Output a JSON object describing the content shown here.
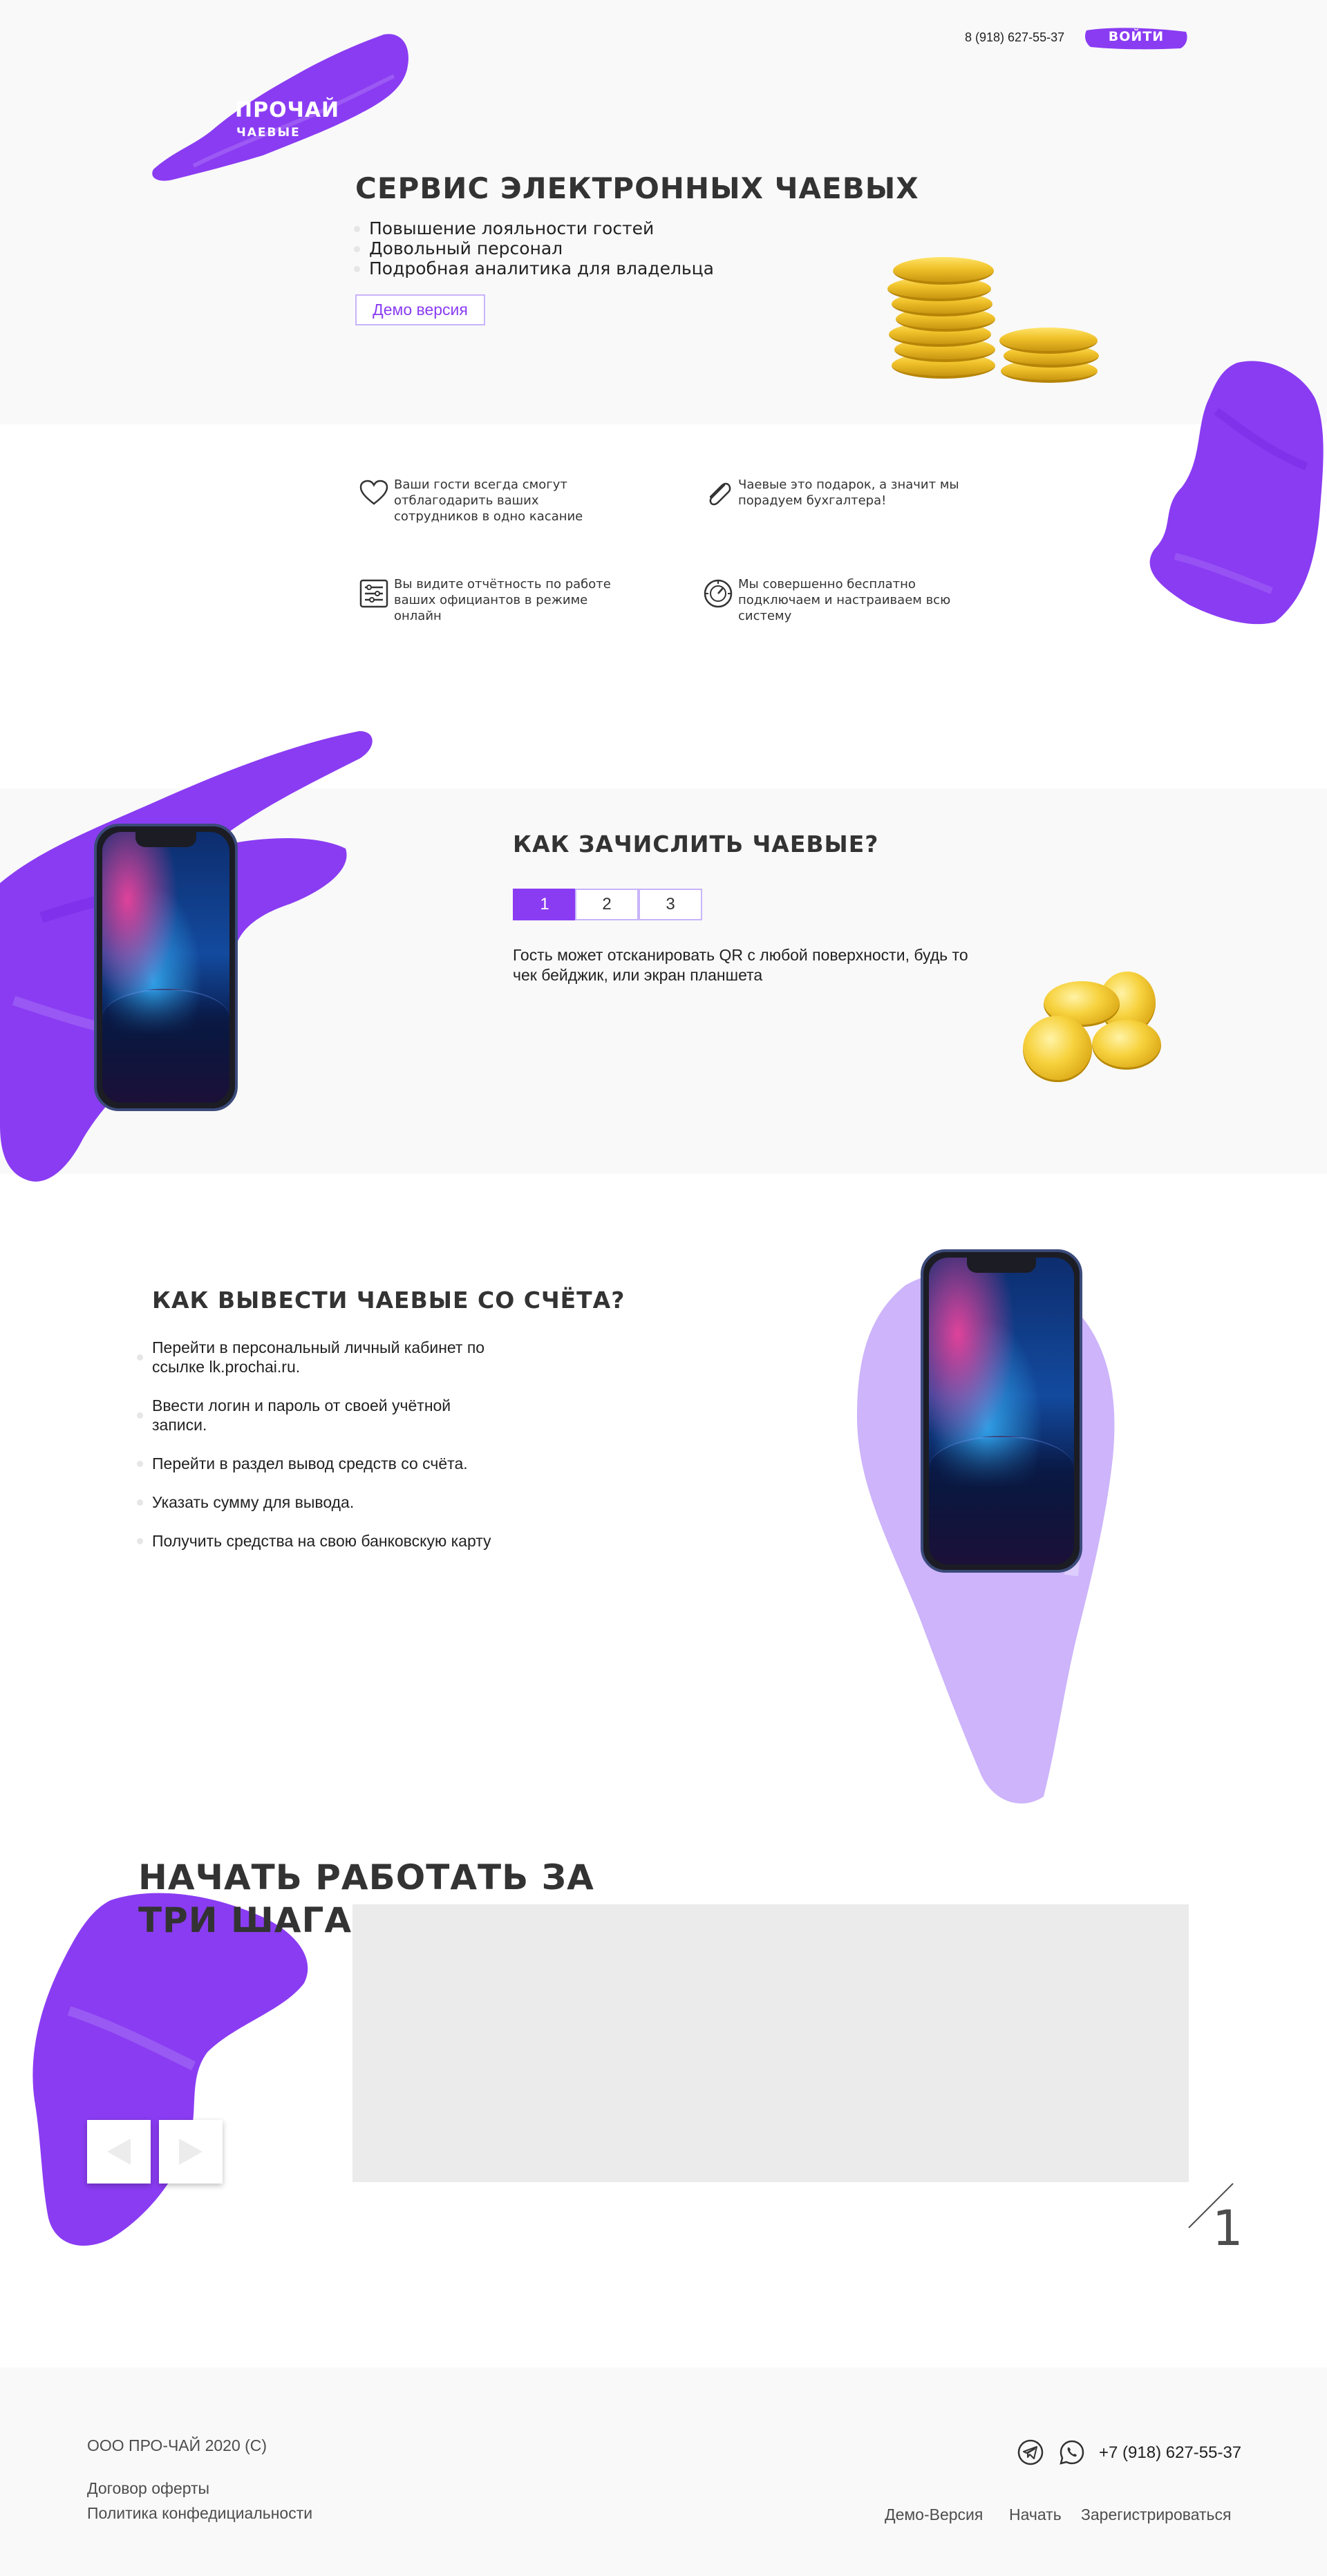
{
  "header": {
    "logo_title": "ПРОЧАЙ",
    "logo_subtitle": "ЧАЕВЫЕ",
    "phone": "8 (918) 627-55-37",
    "login_label": "ВОЙТИ"
  },
  "hero": {
    "title": "СЕРВИС ЭЛЕКТРОННЫХ ЧАЕВЫХ",
    "bullets": [
      "Повышение лояльности  гостей",
      "Довольный персонал",
      "Подробная аналитика для владельца"
    ],
    "demo_label": "Демо версия"
  },
  "features": [
    {
      "icon": "heart-icon",
      "text": "Ваши гости всегда смогут отблагодарить ваших сотрудников в одно касание"
    },
    {
      "icon": "paperclip-icon",
      "text": "Чаевые это подарок, а значит мы порадуем бухгалтера!"
    },
    {
      "icon": "report-icon",
      "text": "Вы видите отчётность по работе ваших официантов в режиме онлайн"
    },
    {
      "icon": "dashboard-icon",
      "text": "Мы совершенно бесплатно подключаем и настраиваем всю систему"
    }
  ],
  "credit": {
    "title": "КАК ЗАЧИСЛИТЬ ЧАЕВЫЕ?",
    "tabs": [
      "1",
      "2",
      "3"
    ],
    "active_tab": "1",
    "text": "Гость может отсканировать QR с любой поверхности, будь то чек бейджик, или экран планшета"
  },
  "withdraw": {
    "title": "КАК ВЫВЕСТИ ЧАЕВЫЕ СО СЧЁТА?",
    "steps": [
      "Перейти в персональный личный кабинет по ссылке lk.prochai.ru.",
      "Ввести логин и пароль от своей учётной записи.",
      "Перейти в раздел вывод средств со счёта.",
      "Указать сумму для вывода.",
      "Получить средства на свою банковскую карту"
    ]
  },
  "start": {
    "title_line1": "НАЧАТЬ РАБОТАТЬ ЗА",
    "title_line2": "ТРИ ШАГА",
    "slide_number": "1"
  },
  "footer": {
    "copyright": "ООО ПРО-ЧАЙ 2020 (С)",
    "offer_link": "Договор оферты",
    "privacy_link": "Политика конфедициальности",
    "phone": "+7 (918) 627-55-37",
    "nav": [
      "Демо-Версия",
      "Начать",
      "Зарегистрироваться"
    ]
  },
  "colors": {
    "accent": "#8a3cf2",
    "accent_light": "#cdb4fb",
    "text": "#333333",
    "band_grey": "#f9f9f9"
  }
}
